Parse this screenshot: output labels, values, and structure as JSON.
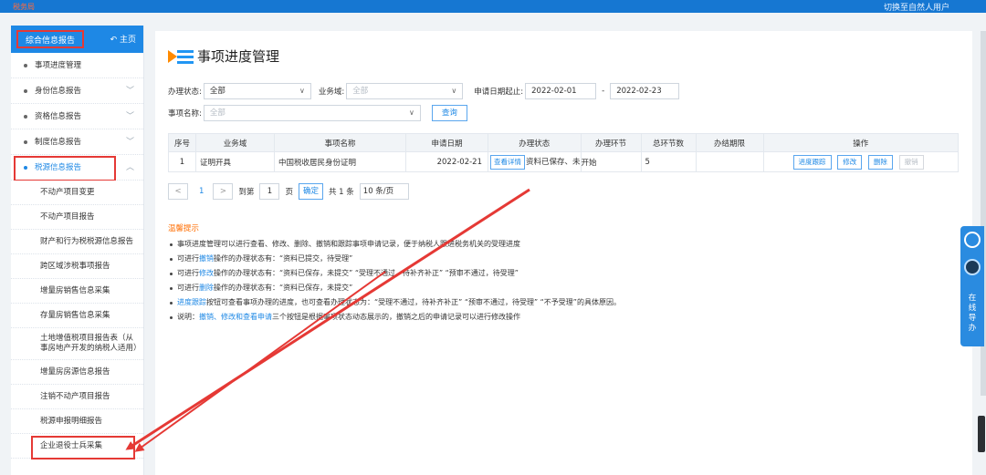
{
  "topbar": {
    "logo": "税务局",
    "user": "切换至自然人用户"
  },
  "sidebar": {
    "header_title": "综合信息报告",
    "home_label": "主页",
    "items": [
      {
        "label": "事项进度管理"
      },
      {
        "label": "身份信息报告"
      },
      {
        "label": "资格信息报告"
      },
      {
        "label": "制度信息报告"
      },
      {
        "label": "税源信息报告"
      }
    ],
    "sub_items": [
      "不动产项目变更",
      "不动产项目报告",
      "财产和行为税税源信息报告",
      "跨区域涉税事项报告",
      "增量房销售信息采集",
      "存量房销售信息采集",
      "土地增值税项目报告表（从事房地产开发的纳税人适用）",
      "增量房房源信息报告",
      "注销不动产项目报告",
      "税源申报明细报告",
      "企业退役士兵采集"
    ]
  },
  "main": {
    "title": "事项进度管理",
    "filters": {
      "status_label": "办理状态:",
      "status_value": "全部",
      "domain_label": "业务域:",
      "domain_placeholder": "全部",
      "date_label": "申请日期起止:",
      "date_from": "2022-02-01",
      "date_sep": "-",
      "date_to": "2022-02-23",
      "name_label": "事项名称:",
      "name_placeholder": "全部",
      "query_button": "查询"
    },
    "table": {
      "headers": [
        "序号",
        "业务域",
        "事项名称",
        "申请日期",
        "办理状态",
        "办理环节",
        "总环节数",
        "办结期限",
        "操作"
      ],
      "rows": [
        {
          "index": "1",
          "domain": "证明开具",
          "name": "中国税收居民身份证明",
          "date": "2022-02-21",
          "status_btn": "查看详情",
          "status_text": "资料已保存、未",
          "step": "开始",
          "total": "5",
          "deadline": "",
          "ops": [
            "进度跟踪",
            "修改",
            "删除",
            "撤销"
          ]
        }
      ]
    },
    "pager": {
      "prev": "<",
      "current": "1",
      "next": ">",
      "goto_label": "到第",
      "goto_value": "1",
      "page_unit": "页",
      "confirm": "确定",
      "total": "共 1 条",
      "page_size": "10 条/页"
    },
    "tips_title": "温馨提示",
    "tips": [
      {
        "pre": "事项进度管理可以进行查看、修改、删除、撤销和跟踪事项申请记录，便于纳税人跟进税务机关的受理进度",
        "hl": "",
        "post": ""
      },
      {
        "pre": "可进行",
        "hl": "撤销",
        "post": "操作的办理状态有：“资料已提交，待受理”"
      },
      {
        "pre": "可进行",
        "hl": "修改",
        "post": "操作的办理状态有：“资料已保存，未提交”  “受理不通过，待补齐补正”  “预审不通过，待受理”"
      },
      {
        "pre": "可进行",
        "hl": "删除",
        "post": "操作的办理状态有：“资料已保存，未提交”"
      },
      {
        "pre": "",
        "hl": "进度跟踪",
        "post": "按钮可查看事项办理的进度，也可查看办理状态为：“受理不通过，待补齐补正”  “预审不通过，待受理”  “不予受理”的具体原因。"
      },
      {
        "pre": "说明：",
        "hl": "撤销、修改和查看申请",
        "post": "三个按钮是根据事项状态动态展示的，撤销之后的申请记录可以进行修改操作"
      }
    ]
  },
  "widget": {
    "text": "在线导办"
  },
  "colors": {
    "brand": "#1e88e5",
    "highlight_box": "#e53935",
    "tips_title": "#ff6d00"
  }
}
